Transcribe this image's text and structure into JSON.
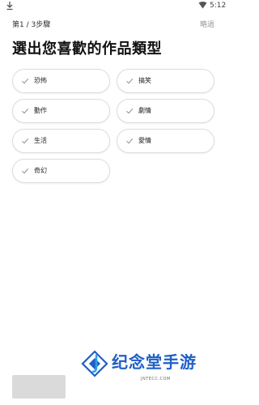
{
  "status_bar": {
    "time": "5:12",
    "download_icon": "download-icon",
    "wifi_icon": "wifi-icon"
  },
  "header": {
    "step": "第1 / 3步驟",
    "skip_label": "略過"
  },
  "title": "選出您喜歡的作品類型",
  "genres": [
    {
      "label": "恐怖",
      "selected": false
    },
    {
      "label": "搞笑",
      "selected": false
    },
    {
      "label": "動作",
      "selected": false
    },
    {
      "label": "劇情",
      "selected": false
    },
    {
      "label": "生活",
      "selected": false
    },
    {
      "label": "愛情",
      "selected": false
    },
    {
      "label": "奇幻",
      "selected": false
    }
  ],
  "next_button": {
    "label": "",
    "color": "#dadada"
  },
  "watermark": {
    "name": "纪念堂手游",
    "url": "JNTECC.COM",
    "color": "#1f5fc7"
  },
  "colors": {
    "chip_border": "#dcdcdc",
    "check": "#8a8a8a",
    "skip_text": "#9a9a9a"
  }
}
